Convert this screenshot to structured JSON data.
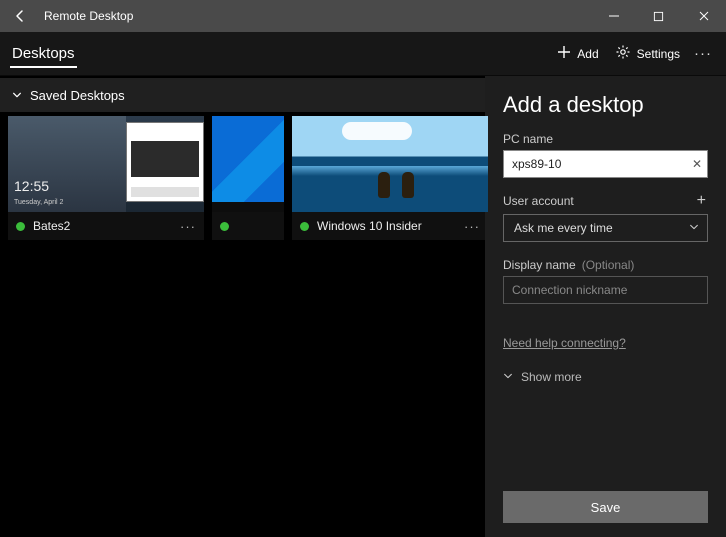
{
  "titlebar": {
    "title": "Remote Desktop"
  },
  "cmdbar": {
    "tab_label": "Desktops",
    "add_label": "Add",
    "settings_label": "Settings"
  },
  "group": {
    "header": "Saved Desktops",
    "tiles": [
      {
        "name": "Bates2",
        "clock": "12:55",
        "date": "Tuesday, April 2"
      },
      {
        "name": ""
      },
      {
        "name": "Windows 10 Insider"
      }
    ]
  },
  "panel": {
    "title": "Add a desktop",
    "pcname_label": "PC name",
    "pcname_value": "xps89-10",
    "useracct_label": "User account",
    "useracct_value": "Ask me every time",
    "display_label": "Display name",
    "display_optional": "(Optional)",
    "display_placeholder": "Connection nickname",
    "help_link": "Need help connecting?",
    "show_more": "Show more",
    "save_label": "Save"
  }
}
